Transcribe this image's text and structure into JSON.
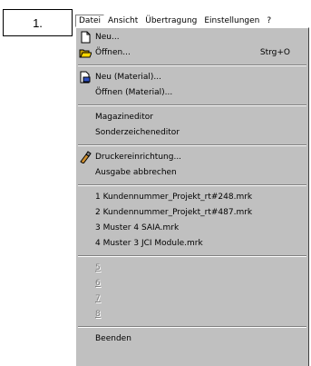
{
  "callout_label": "1.",
  "menubar": {
    "datei": "Datei",
    "ansicht": "Ansicht",
    "uebertragung": "Übertragung",
    "einstellungen": "Einstellungen",
    "help": "?"
  },
  "items": {
    "neu": "Neu...",
    "oeffnen": "Öffnen...",
    "oeffnen_shortcut": "Strg+O",
    "neu_material": "Neu (Material)...",
    "oeffnen_material": "Öffnen (Material)...",
    "magazineditor": "Magazineditor",
    "sonderzeicheneditor": "Sonderzeicheneditor",
    "druckereinrichtung": "Druckereinrichtung...",
    "ausgabe_abbrechen": "Ausgabe abbrechen",
    "recent1": "1 Kundennummer_Projekt_rt#248.mrk",
    "recent2": "2 Kundennummer_Projekt_rt#487.mrk",
    "recent3": "3 Muster 4 SAIA.mrk",
    "recent4": "4 Muster 3 JCI Module.mrk",
    "slot5": "5",
    "slot6": "6",
    "slot7": "7",
    "slot8": "8",
    "beenden": "Beenden"
  },
  "icons": {
    "neu": "new-document-icon",
    "oeffnen": "open-folder-icon",
    "neu_material": "new-material-icon",
    "druckereinrichtung": "printer-setup-icon"
  }
}
